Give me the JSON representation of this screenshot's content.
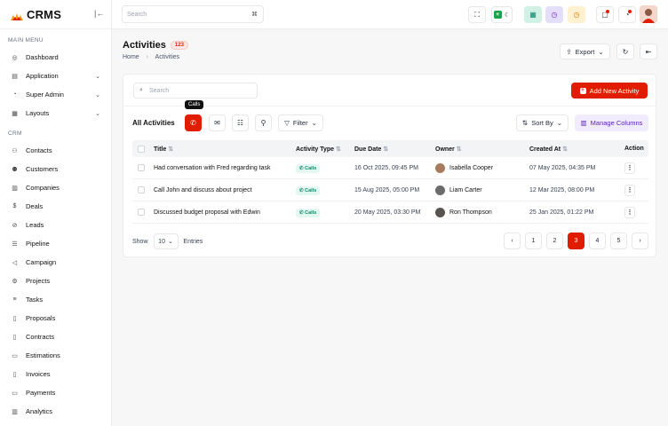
{
  "brand": {
    "name": "CRMS"
  },
  "sidebar": {
    "main_menu_label": "MAIN MENU",
    "main_items": [
      {
        "label": "Dashboard",
        "icon": "dashboard-icon"
      },
      {
        "label": "Application",
        "icon": "application-icon",
        "has_chevron": true
      },
      {
        "label": "Super Admin",
        "icon": "super-admin-icon",
        "has_chevron": true
      },
      {
        "label": "Layouts",
        "icon": "layouts-icon",
        "has_chevron": true
      }
    ],
    "crm_label": "CRM",
    "crm_items": [
      {
        "label": "Contacts"
      },
      {
        "label": "Customers"
      },
      {
        "label": "Companies"
      },
      {
        "label": "Deals"
      },
      {
        "label": "Leads"
      },
      {
        "label": "Pipeline"
      },
      {
        "label": "Campaign"
      },
      {
        "label": "Projects"
      },
      {
        "label": "Tasks"
      },
      {
        "label": "Proposals"
      },
      {
        "label": "Contracts"
      },
      {
        "label": "Estimations"
      },
      {
        "label": "Invoices"
      },
      {
        "label": "Payments"
      },
      {
        "label": "Analytics"
      }
    ]
  },
  "topbar": {
    "search_placeholder": "Search",
    "shortcut": "⌘"
  },
  "header": {
    "title": "Activities",
    "count": "123",
    "breadcrumb": [
      "Home",
      "Activities"
    ],
    "export_label": "Export"
  },
  "card": {
    "search_placeholder": "Search",
    "add_button": "Add New Activity",
    "all_title": "All Activities",
    "tooltip": "Calls",
    "filter_label": "Filter",
    "sort_label": "Sort By",
    "manage_columns": "Manage Columns"
  },
  "table": {
    "headers": {
      "title": "Title",
      "type": "Activity Type",
      "due": "Due Date",
      "owner": "Owner",
      "created": "Created At",
      "action": "Action"
    },
    "rows": [
      {
        "title": "Had conversation with Fred regarding task",
        "type": "Calls",
        "due": "16 Oct 2025, 09:45 PM",
        "owner": "Isabella Cooper",
        "created": "07 May 2025, 04:35 PM"
      },
      {
        "title": "Call John and discuss about project",
        "type": "Calls",
        "due": "15 Aug 2025, 05:00 PM",
        "owner": "Liam Carter",
        "created": "12 Mar 2025, 08:00 PM"
      },
      {
        "title": "Discussed budget proposal with Edwin",
        "type": "Calls",
        "due": "20 May 2025, 03:30 PM",
        "owner": "Ron Thompson",
        "created": "25 Jan 2025, 01:22 PM"
      }
    ]
  },
  "footer": {
    "show_label": "Show",
    "show_value": "10",
    "entries_label": "Entries",
    "pages": [
      "1",
      "2",
      "3",
      "4",
      "5"
    ],
    "current_page": "3"
  },
  "colors": {
    "accent": "#e11d00",
    "purple_bg": "#f1ecfd",
    "badge_bg": "#e3f7f1"
  }
}
